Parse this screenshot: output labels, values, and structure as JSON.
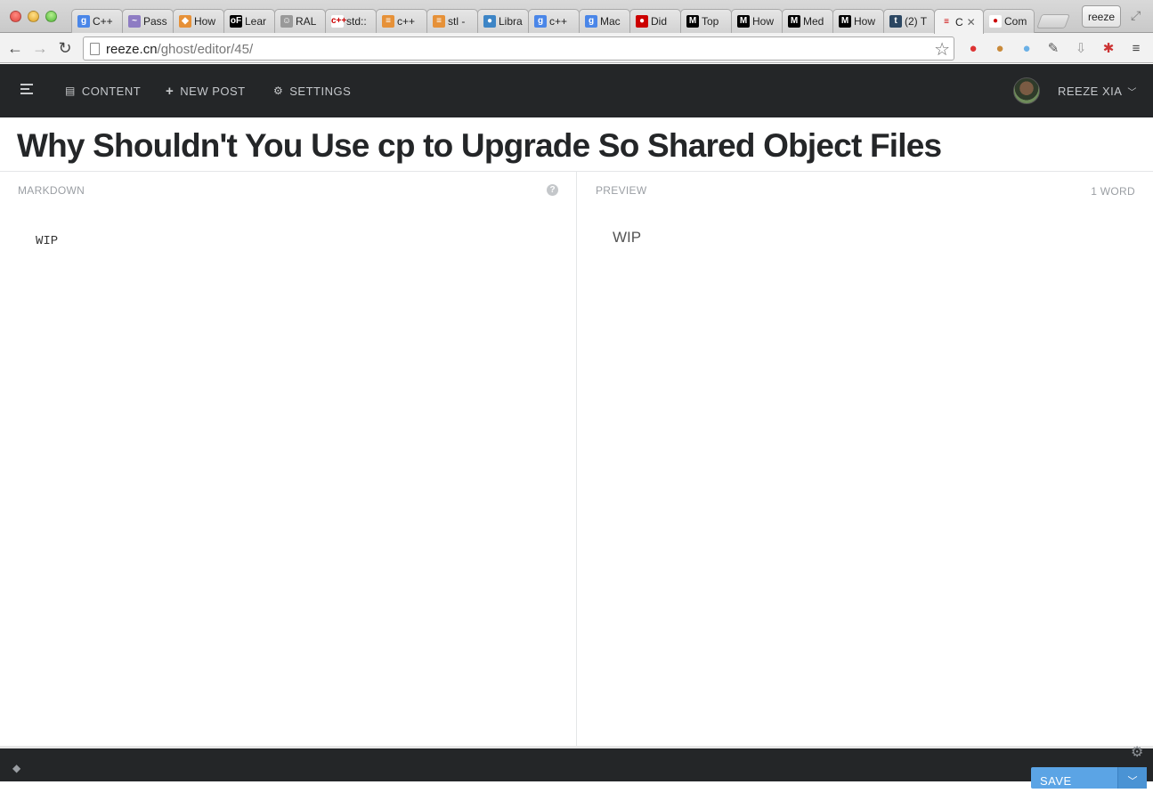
{
  "browser": {
    "tabs": [
      {
        "icon": "google-icon",
        "label": "C++",
        "fav_bg": "#4a86e8",
        "glyph": "g"
      },
      {
        "icon": "pass-icon",
        "label": "Pass",
        "fav_bg": "#8e7cc3",
        "glyph": "~"
      },
      {
        "icon": "folder-icon",
        "label": "How",
        "fav_bg": "#e69138",
        "glyph": "◆"
      },
      {
        "icon": "of-icon",
        "label": "Lear",
        "fav_bg": "#000000",
        "glyph": "oF"
      },
      {
        "icon": "cat-icon",
        "label": "RAL",
        "fav_bg": "#999999",
        "glyph": "☺"
      },
      {
        "icon": "cpp-icon",
        "label": "std::",
        "fav_bg": "#ffffff",
        "glyph": "c++"
      },
      {
        "icon": "stackoverflow-icon",
        "label": "c++",
        "fav_bg": "#e69138",
        "glyph": "≡"
      },
      {
        "icon": "stackoverflow-icon",
        "label": "stl -",
        "fav_bg": "#e69138",
        "glyph": "≡"
      },
      {
        "icon": "libra-icon",
        "label": "Libra",
        "fav_bg": "#3d85c6",
        "glyph": "●"
      },
      {
        "icon": "google-icon",
        "label": "c++",
        "fav_bg": "#4a86e8",
        "glyph": "g"
      },
      {
        "icon": "google-icon",
        "label": "Mac",
        "fav_bg": "#4a86e8",
        "glyph": "g"
      },
      {
        "icon": "apple-icon",
        "label": "Did",
        "fav_bg": "#cc0000",
        "glyph": "●"
      },
      {
        "icon": "medium-icon",
        "label": "Top",
        "fav_bg": "#000000",
        "glyph": "M"
      },
      {
        "icon": "medium-icon",
        "label": "How",
        "fav_bg": "#000000",
        "glyph": "M"
      },
      {
        "icon": "medium-icon",
        "label": "Med",
        "fav_bg": "#000000",
        "glyph": "M"
      },
      {
        "icon": "medium-icon",
        "label": "How",
        "fav_bg": "#000000",
        "glyph": "M"
      },
      {
        "icon": "tumblr-icon",
        "label": "(2) T",
        "fav_bg": "#2c4762",
        "glyph": "t"
      },
      {
        "icon": "ghost-icon",
        "label": "C",
        "fav_bg": "#f2f2f2",
        "glyph": "≡",
        "active": true
      },
      {
        "icon": "github-icon",
        "label": "Com",
        "fav_bg": "#ffffff",
        "glyph": "●"
      }
    ],
    "profile_label": "reeze",
    "url_host": "reeze.cn",
    "url_path": "/ghost/editor/45/"
  },
  "nav": {
    "content_label": "CONTENT",
    "new_post_label": "NEW POST",
    "settings_label": "SETTINGS",
    "user_label": "REEZE XIA"
  },
  "editor": {
    "title": "Why Shouldn't You Use cp to Upgrade So Shared Object Files",
    "markdown_label": "MARKDOWN",
    "preview_label": "PREVIEW",
    "word_count": "1 WORD",
    "markdown_text": "WIP",
    "preview_text": "WIP"
  },
  "footer": {
    "save_label": "SAVE DRAFT"
  }
}
